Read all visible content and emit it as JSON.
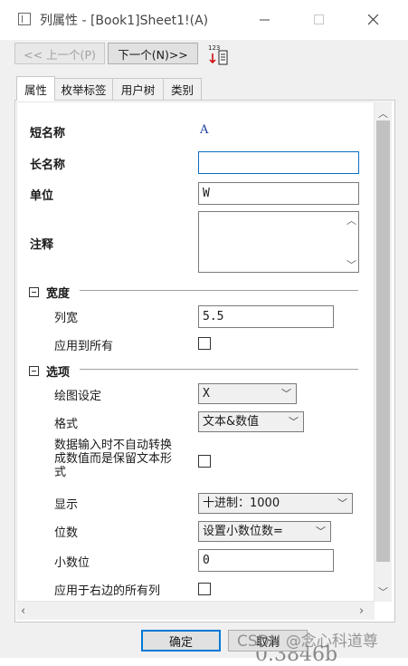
{
  "window": {
    "title": "列属性 - [Book1]Sheet1!(A)",
    "minimize_icon": "minimize-icon",
    "maximize_icon": "maximize-icon",
    "close_icon": "close-icon"
  },
  "nav": {
    "prev_label": "<< 上一个(P)",
    "next_label": "下一个(N)>>",
    "tool_icon_text": "123"
  },
  "tabs": [
    {
      "label": "属性",
      "active": true
    },
    {
      "label": "枚举标签",
      "active": false
    },
    {
      "label": "用户树",
      "active": false
    },
    {
      "label": "类别",
      "active": false
    }
  ],
  "properties": {
    "short_name_label": "短名称",
    "short_name_value": "A",
    "long_name_label": "长名称",
    "long_name_value": "",
    "unit_label": "单位",
    "unit_value": "W",
    "comment_label": "注释",
    "comment_value": ""
  },
  "width_section": {
    "title": "宽度",
    "column_width_label": "列宽",
    "column_width_value": "5.5",
    "apply_all_label": "应用到所有",
    "apply_all_checked": false
  },
  "options_section": {
    "title": "选项",
    "plot_designation_label": "绘图设定",
    "plot_designation_value": "X",
    "format_label": "格式",
    "format_value": "文本&数值",
    "keep_text_label_line1": "数据输入时不自动转换",
    "keep_text_label_line2": "成数值而是保留文本形",
    "keep_text_label_line3": "式",
    "keep_text_checked": false,
    "display_label": "显示",
    "display_value": "十进制：1000",
    "digits_label": "位数",
    "digits_value": "设置小数位数=",
    "decimal_places_label": "小数位",
    "decimal_places_value": "0",
    "apply_right_label": "应用于右边的所有列",
    "apply_right_checked": false
  },
  "footer": {
    "ok_label": "确定",
    "cancel_label": "取消"
  },
  "overlay": {
    "watermark": "CSDN @念心科道尊",
    "background_text": "0.3846b"
  },
  "colors": {
    "accent": "#0078d7",
    "value_blue": "#1b3f9a",
    "panel_bg": "#ffffff",
    "window_bg": "#f0f0f0"
  }
}
